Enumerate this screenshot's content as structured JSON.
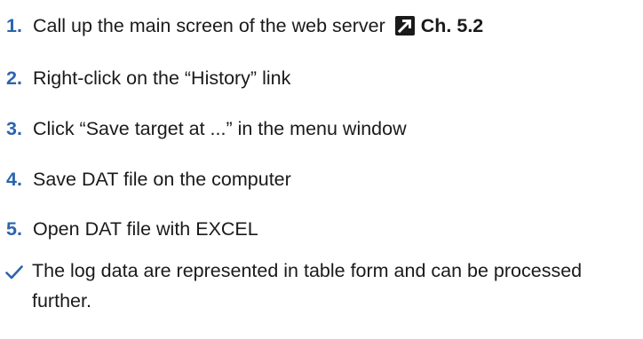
{
  "steps": [
    {
      "number": "1.",
      "text": "Call up the main screen of the web server",
      "ref_icon": "external-reference-arrow-icon",
      "ref_text": "Ch. 5.2"
    },
    {
      "number": "2.",
      "text": "Right-click on the “History” link"
    },
    {
      "number": "3.",
      "text": "Click “Save target at ...” in the menu window"
    },
    {
      "number": "4.",
      "text": "Save DAT file on the computer"
    },
    {
      "number": "5.",
      "text": "Open DAT file with EXCEL"
    }
  ],
  "result": {
    "icon": "checkmark-icon",
    "text": "The log data are represented in table form and can be processed further."
  },
  "colors": {
    "step_number": "#2b64ae",
    "body_text": "#1a1a1a",
    "checkmark": "#2b64ae"
  }
}
